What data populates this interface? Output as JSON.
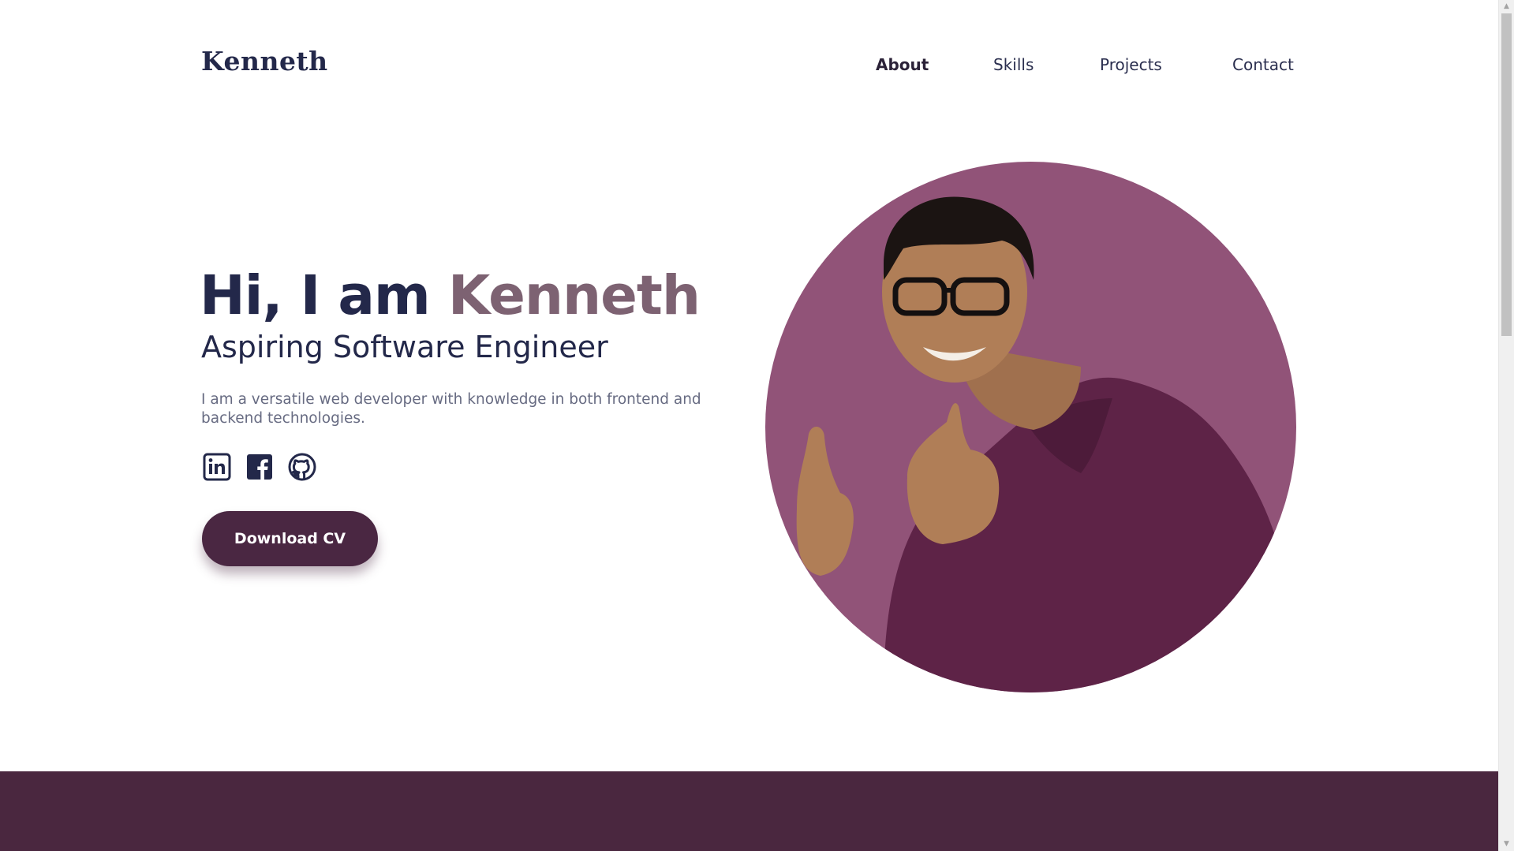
{
  "header": {
    "logo": "Kenneth",
    "nav": [
      {
        "label": "About",
        "active": true
      },
      {
        "label": "Skills",
        "active": false
      },
      {
        "label": "Projects",
        "active": false
      },
      {
        "label": "Contact",
        "active": false
      }
    ]
  },
  "hero": {
    "greeting": "Hi, I am ",
    "name": "Kenneth",
    "subtitle": "Aspiring Software Engineer",
    "description": "I am a versatile web developer with knowledge in both frontend and backend technologies.",
    "socials": [
      {
        "icon": "linkedin-icon"
      },
      {
        "icon": "facebook-icon"
      },
      {
        "icon": "github-icon"
      }
    ],
    "cv_button": "Download CV",
    "portrait_alt": "portrait photo"
  },
  "colors": {
    "primary_dark": "#23284a",
    "accent_name": "#7d6272",
    "button_bg": "#4a2742",
    "portrait_bg": "#915378",
    "band_bg": "#4a273f"
  }
}
